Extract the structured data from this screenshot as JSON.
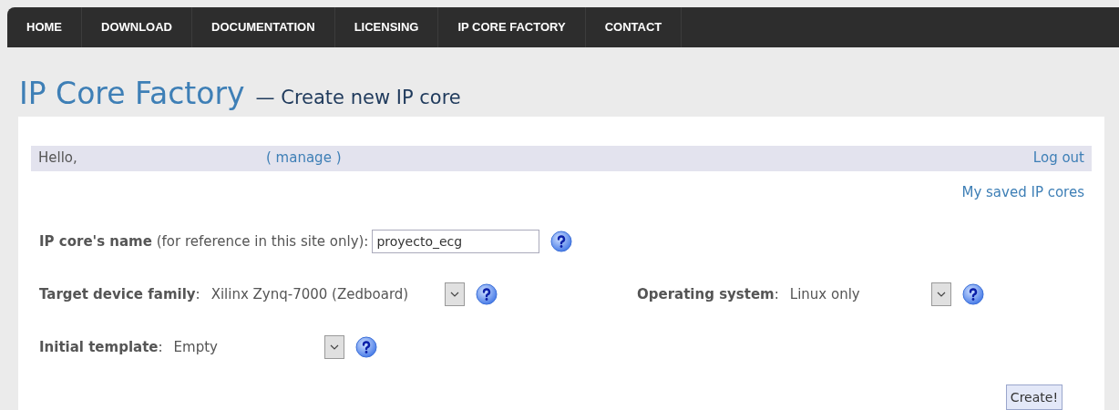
{
  "nav": [
    "HOME",
    "DOWNLOAD",
    "DOCUMENTATION",
    "LICENSING",
    "IP CORE FACTORY",
    "CONTACT"
  ],
  "title": "IP Core Factory",
  "subtitle": "— Create new IP core",
  "user_bar": {
    "greeting": "Hello,",
    "manage": "( manage )",
    "logout": "Log out"
  },
  "saved_link": "My saved IP cores",
  "name_field": {
    "label": "IP core's name",
    "hint": "(for reference in this site only):",
    "value": "proyecto_ecg"
  },
  "selects": [
    {
      "label": "**Target device family**:",
      "value": "Xilinx Zynq-7000 (Zedboard)"
    },
    {
      "label": "**Operating system**:",
      "value": "Linux only"
    },
    {
      "label": "**Initial template**:",
      "value": "Empty"
    }
  ],
  "create_button": "Create!"
}
